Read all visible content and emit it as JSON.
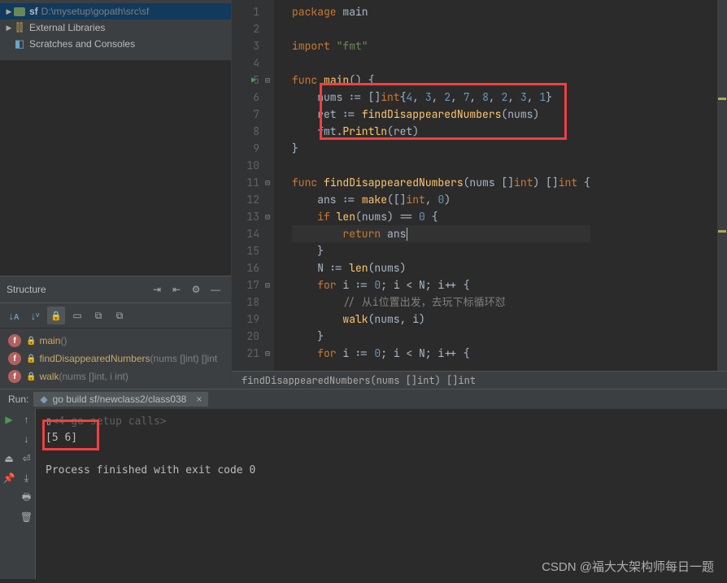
{
  "project": {
    "root_name": "sf",
    "root_path": "D:\\mysetup\\gopath\\src\\sf",
    "external_libs": "External Libraries",
    "scratches": "Scratches and Consoles"
  },
  "structure": {
    "title": "Structure",
    "items": [
      {
        "name": "main",
        "sig": "()"
      },
      {
        "name": "findDisappearedNumbers",
        "sig": "(nums []int) []int"
      },
      {
        "name": "walk",
        "sig": "(nums []int, i int)"
      }
    ]
  },
  "editor": {
    "lines": [
      {
        "n": 1,
        "tokens": [
          {
            "c": "kw",
            "t": "package "
          },
          {
            "c": "id",
            "t": "main"
          }
        ]
      },
      {
        "n": 2,
        "tokens": []
      },
      {
        "n": 3,
        "tokens": [
          {
            "c": "kw",
            "t": "import "
          },
          {
            "c": "str",
            "t": "\"fmt\""
          }
        ]
      },
      {
        "n": 4,
        "tokens": []
      },
      {
        "n": 5,
        "run": true,
        "fold": true,
        "tokens": [
          {
            "c": "kw",
            "t": "func "
          },
          {
            "c": "fn",
            "t": "main"
          },
          {
            "c": "id",
            "t": "() {"
          }
        ]
      },
      {
        "n": 6,
        "tokens": [
          {
            "c": "id",
            "t": "    nums := []"
          },
          {
            "c": "typ",
            "t": "int"
          },
          {
            "c": "id",
            "t": "{"
          },
          {
            "c": "num",
            "t": "4"
          },
          {
            "c": "id",
            "t": ", "
          },
          {
            "c": "num",
            "t": "3"
          },
          {
            "c": "id",
            "t": ", "
          },
          {
            "c": "num",
            "t": "2"
          },
          {
            "c": "id",
            "t": ", "
          },
          {
            "c": "num",
            "t": "7"
          },
          {
            "c": "id",
            "t": ", "
          },
          {
            "c": "num",
            "t": "8"
          },
          {
            "c": "id",
            "t": ", "
          },
          {
            "c": "num",
            "t": "2"
          },
          {
            "c": "id",
            "t": ", "
          },
          {
            "c": "num",
            "t": "3"
          },
          {
            "c": "id",
            "t": ", "
          },
          {
            "c": "num",
            "t": "1"
          },
          {
            "c": "id",
            "t": "}"
          }
        ]
      },
      {
        "n": 7,
        "tokens": [
          {
            "c": "id",
            "t": "    ret := "
          },
          {
            "c": "fn",
            "t": "findDisappearedNumbers"
          },
          {
            "c": "id",
            "t": "(nums)"
          }
        ]
      },
      {
        "n": 8,
        "tokens": [
          {
            "c": "id",
            "t": "    fmt."
          },
          {
            "c": "fn",
            "t": "Println"
          },
          {
            "c": "id",
            "t": "(ret)"
          }
        ]
      },
      {
        "n": 9,
        "tokens": [
          {
            "c": "id",
            "t": "}"
          }
        ]
      },
      {
        "n": 10,
        "tokens": []
      },
      {
        "n": 11,
        "fold": true,
        "tokens": [
          {
            "c": "kw",
            "t": "func "
          },
          {
            "c": "fn",
            "t": "findDisappearedNumbers"
          },
          {
            "c": "id",
            "t": "(nums []"
          },
          {
            "c": "typ",
            "t": "int"
          },
          {
            "c": "id",
            "t": ") []"
          },
          {
            "c": "typ",
            "t": "int"
          },
          {
            "c": "id",
            "t": " {"
          }
        ]
      },
      {
        "n": 12,
        "tokens": [
          {
            "c": "id",
            "t": "    ans := "
          },
          {
            "c": "fn",
            "t": "make"
          },
          {
            "c": "id",
            "t": "([]"
          },
          {
            "c": "typ",
            "t": "int"
          },
          {
            "c": "id",
            "t": ", "
          },
          {
            "c": "num",
            "t": "0"
          },
          {
            "c": "id",
            "t": ")"
          }
        ]
      },
      {
        "n": 13,
        "fold": true,
        "tokens": [
          {
            "c": "id",
            "t": "    "
          },
          {
            "c": "kw",
            "t": "if "
          },
          {
            "c": "fn",
            "t": "len"
          },
          {
            "c": "id",
            "t": "(nums) == "
          },
          {
            "c": "num",
            "t": "0"
          },
          {
            "c": "id",
            "t": " {"
          }
        ]
      },
      {
        "n": 14,
        "current": true,
        "tokens": [
          {
            "c": "id",
            "t": "        "
          },
          {
            "c": "kw",
            "t": "return "
          },
          {
            "c": "id",
            "t": "ans"
          }
        ],
        "cursor": true
      },
      {
        "n": 15,
        "tokens": [
          {
            "c": "id",
            "t": "    }"
          }
        ]
      },
      {
        "n": 16,
        "tokens": [
          {
            "c": "id",
            "t": "    N := "
          },
          {
            "c": "fn",
            "t": "len"
          },
          {
            "c": "id",
            "t": "(nums)"
          }
        ]
      },
      {
        "n": 17,
        "fold": true,
        "tokens": [
          {
            "c": "id",
            "t": "    "
          },
          {
            "c": "kw",
            "t": "for "
          },
          {
            "c": "id",
            "t": "i := "
          },
          {
            "c": "num",
            "t": "0"
          },
          {
            "c": "id",
            "t": "; i < N; i++ {"
          }
        ]
      },
      {
        "n": 18,
        "tokens": [
          {
            "c": "id",
            "t": "        "
          },
          {
            "c": "com",
            "t": "// 从i位置出发，去玩下标循环怼"
          }
        ]
      },
      {
        "n": 19,
        "tokens": [
          {
            "c": "id",
            "t": "        "
          },
          {
            "c": "fn",
            "t": "walk"
          },
          {
            "c": "id",
            "t": "(nums, i)"
          }
        ]
      },
      {
        "n": 20,
        "tokens": [
          {
            "c": "id",
            "t": "    }"
          }
        ]
      },
      {
        "n": 21,
        "fold": true,
        "tokens": [
          {
            "c": "id",
            "t": "    "
          },
          {
            "c": "kw",
            "t": "for "
          },
          {
            "c": "id",
            "t": "i := "
          },
          {
            "c": "num",
            "t": "0"
          },
          {
            "c": "id",
            "t": "; i < N; i++ {"
          }
        ]
      }
    ],
    "breadcrumb": "findDisappearedNumbers(nums []int) []int"
  },
  "run": {
    "label": "Run:",
    "tab_name": "go build sf/newclass2/class038",
    "setup": "<4 go setup calls>",
    "output": "[5 6]",
    "exit": "Process finished with exit code 0"
  },
  "watermark": "CSDN @福大大架构师每日一题"
}
